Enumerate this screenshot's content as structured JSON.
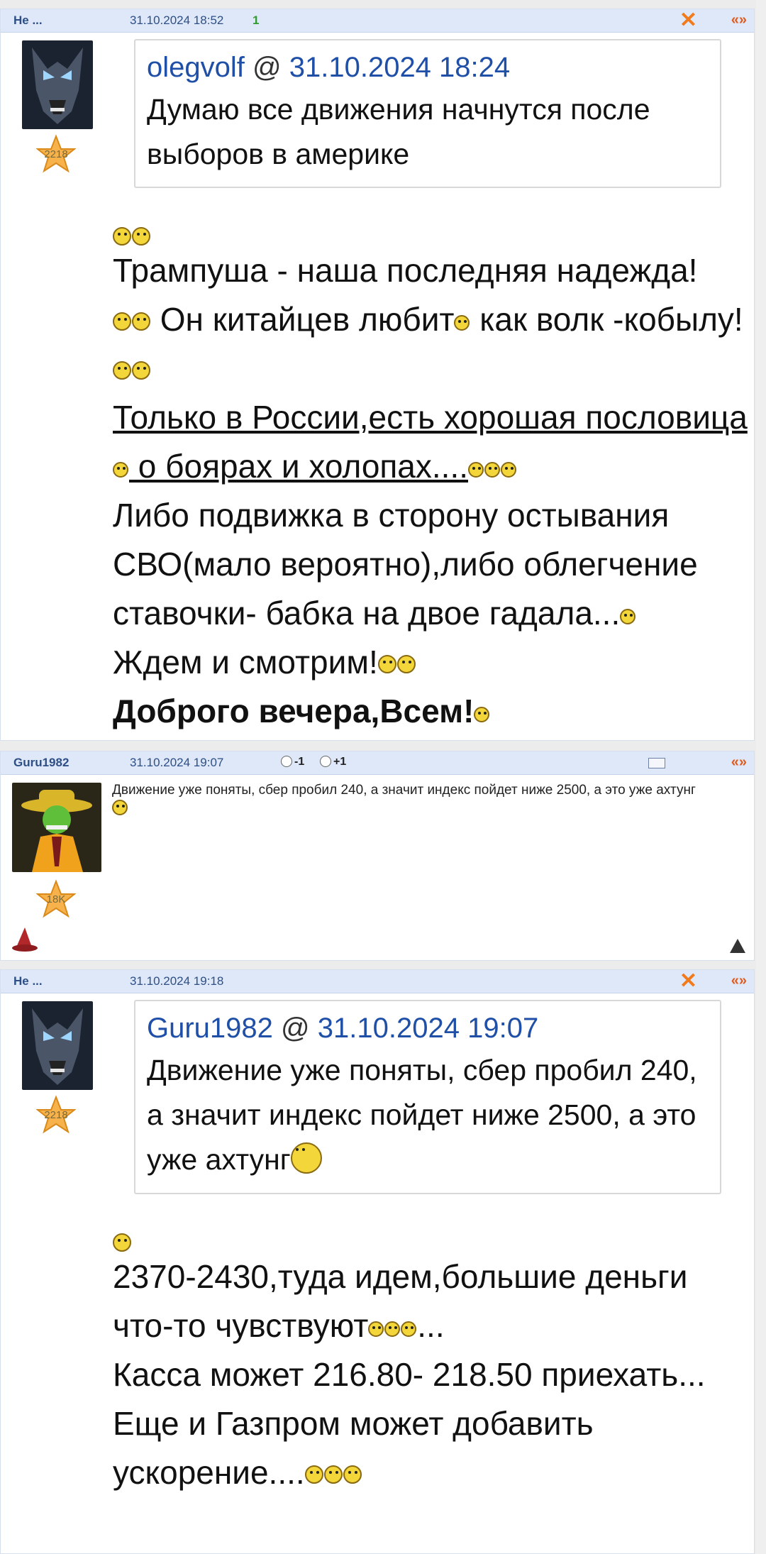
{
  "posts": [
    {
      "author": "Не ...",
      "date": "31.10.2024 18:52",
      "count": "1",
      "close_label": "✕",
      "quote_label": "«»",
      "rating": "2218",
      "quote": {
        "user": "olegvolf",
        "at": "@",
        "date": "31.10.2024 18:24",
        "text": "Думаю все движения начнутся после выборов в америке"
      },
      "lines": [
        "Трампуша - наша последняя надежда!",
        " Он китайцев любит",
        " как волк -кобылу!",
        "Только в России,есть хорошая пословица",
        " о боярах и холопах....",
        "Либо подвижка в сторону остывания СВО(мало вероятно),либо облегчение ставочки- бабка на двое гадала...",
        "Ждем и смотрим!",
        "Доброго вечера,Всем!"
      ]
    },
    {
      "author": "Guru1982",
      "date": "31.10.2024 19:07",
      "vote_minus": "-1",
      "vote_plus": "+1",
      "quote_label": "«»",
      "rating": "18K",
      "text": "Движение уже поняты, сбер пробил 240, а значит индекс пойдет ниже 2500, а это уже ахтунг"
    },
    {
      "author": "Не ...",
      "date": "31.10.2024 19:18",
      "close_label": "✕",
      "quote_label": "«»",
      "rating": "2218",
      "quote": {
        "user": "Guru1982",
        "at": "@",
        "date": "31.10.2024 19:07",
        "text": "Движение уже поняты, сбер пробил 240, а значит индекс пойдет ниже 2500, а это уже ахтунг"
      },
      "lines": [
        "2370-2430,туда идем,большие деньги что-то чувствуют",
        "...",
        "Касса может 216.80- 218.50 приехать...",
        "Еще и Газпром может добавить ускорение...."
      ]
    }
  ],
  "colors": {
    "header_bg": "#dfe8f8",
    "link_blue": "#1f4fa6",
    "close_orange": "#f07a1c"
  }
}
